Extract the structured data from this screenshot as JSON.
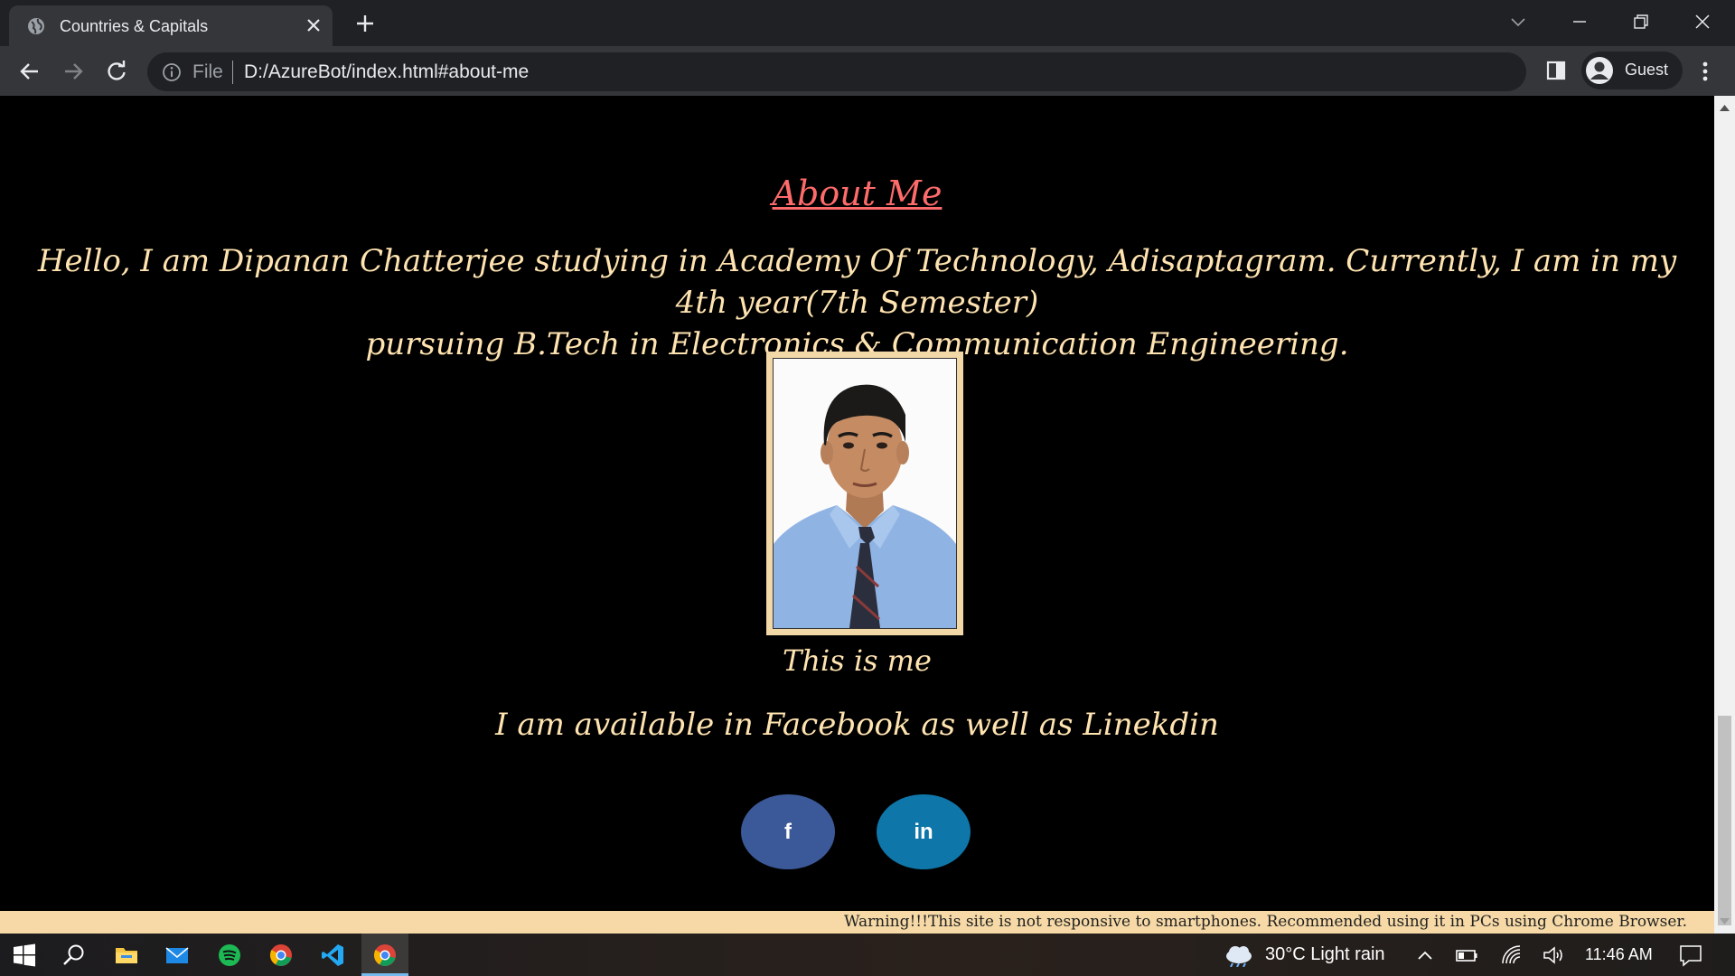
{
  "browser": {
    "tab_title": "Countries & Capitals",
    "omnibox_scheme": "File",
    "url": "D:/AzureBot/index.html#about-me",
    "profile_label": "Guest"
  },
  "page": {
    "about_title": "About Me",
    "intro_line1": "Hello, I am Dipanan Chatterjee studying in Academy Of Technology, Adisaptagram. Currently, I am in my 4th year(7th Semester)",
    "intro_line2": "pursuing B.Tech in Electronics & Communication Engineering.",
    "photo_caption": "This is me",
    "availability": "I am available in Facebook as well as Linekdin",
    "facebook_label": "f",
    "linkedin_label": "in",
    "warning": "Warning!!!This site is not responsive to smartphones. Recommended using it in PCs using Chrome Browser."
  },
  "taskbar": {
    "weather": "30°C  Light rain",
    "time": "11:46 AM"
  },
  "colors": {
    "heading": "#ff6b6b",
    "text": "#ffe3b0",
    "facebook": "#3b5998",
    "linkedin": "#0e76a8",
    "warning_bg": "#f6d9a6"
  }
}
